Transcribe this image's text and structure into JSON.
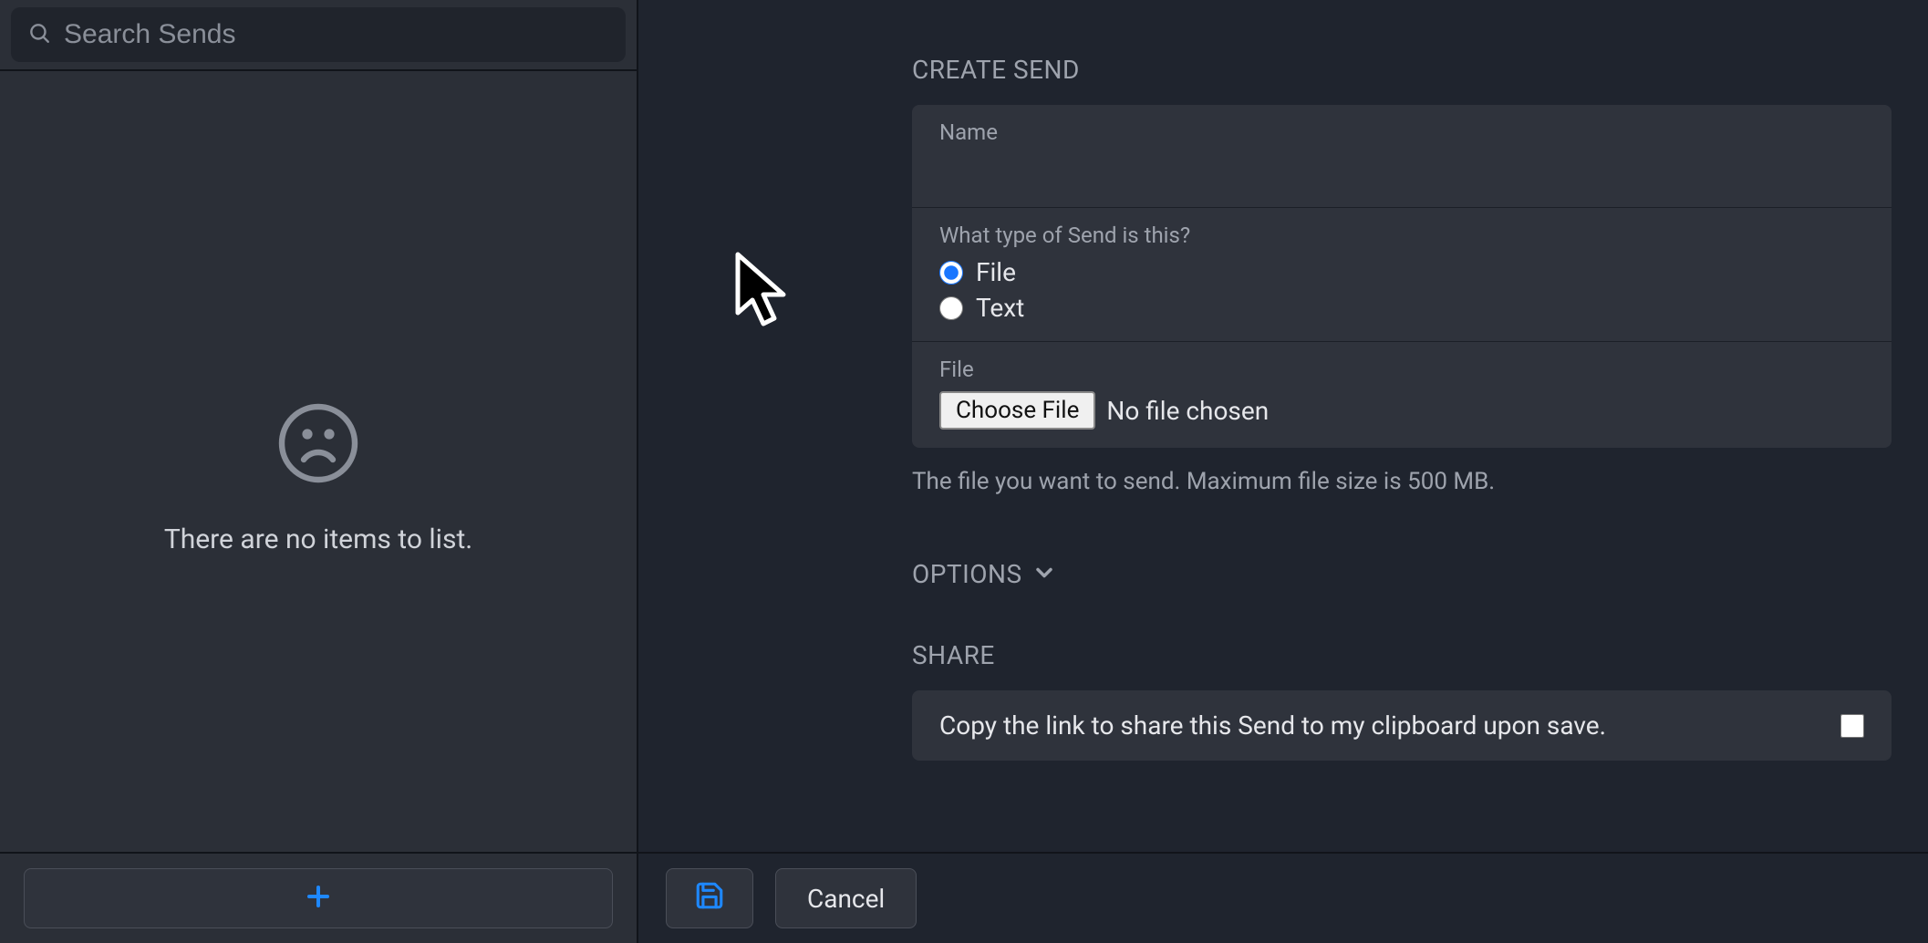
{
  "search": {
    "placeholder": "Search Sends"
  },
  "empty": {
    "text": "There are no items to list."
  },
  "form": {
    "heading": "CREATE SEND",
    "name_label": "Name",
    "name_value": "",
    "type_question": "What type of Send is this?",
    "type_options": {
      "file": "File",
      "text": "Text"
    },
    "file_section_label": "File",
    "choose_file_button": "Choose File",
    "no_file_text": "No file chosen",
    "file_hint": "The file you want to send. Maximum file size is 500 MB."
  },
  "options": {
    "label": "OPTIONS"
  },
  "share": {
    "heading": "SHARE",
    "copy_label": "Copy the link to share this Send to my clipboard upon save."
  },
  "footer": {
    "cancel": "Cancel"
  },
  "colors": {
    "accent_blue": "#1e88ff",
    "panel_bg": "#2f333c",
    "page_bg": "#1f242e"
  }
}
